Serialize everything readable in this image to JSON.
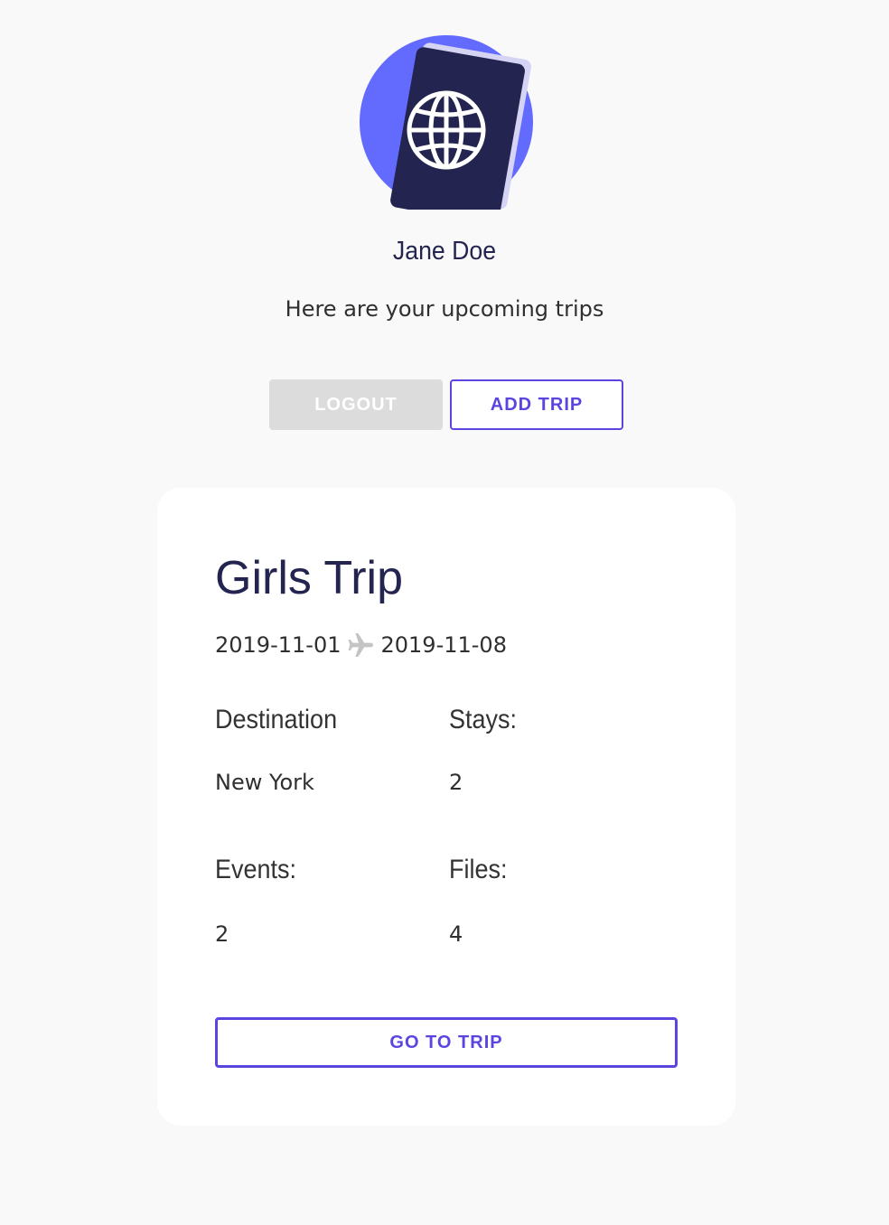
{
  "user": {
    "name": "Jane Doe",
    "greeting": "Here are your upcoming trips"
  },
  "actions": {
    "logout_label": "LOGOUT",
    "add_trip_label": "ADD TRIP"
  },
  "trip": {
    "title": "Girls Trip",
    "start_date": "2019-11-01",
    "end_date": "2019-11-08",
    "destination_label": "Destination",
    "destination_value": "New York",
    "stays_label": "Stays:",
    "stays_value": "2",
    "events_label": "Events:",
    "events_value": "2",
    "files_label": "Files:",
    "files_value": "4",
    "go_label": "GO TO TRIP"
  },
  "icons": {
    "avatar": "passport-globe-icon",
    "date_separator": "airplane-icon"
  },
  "colors": {
    "accent": "#5b45e0",
    "navy": "#232550",
    "avatar_circle": "#636bff",
    "logout_bg": "#dcdcdc",
    "page_bg": "#f9f9f9"
  }
}
